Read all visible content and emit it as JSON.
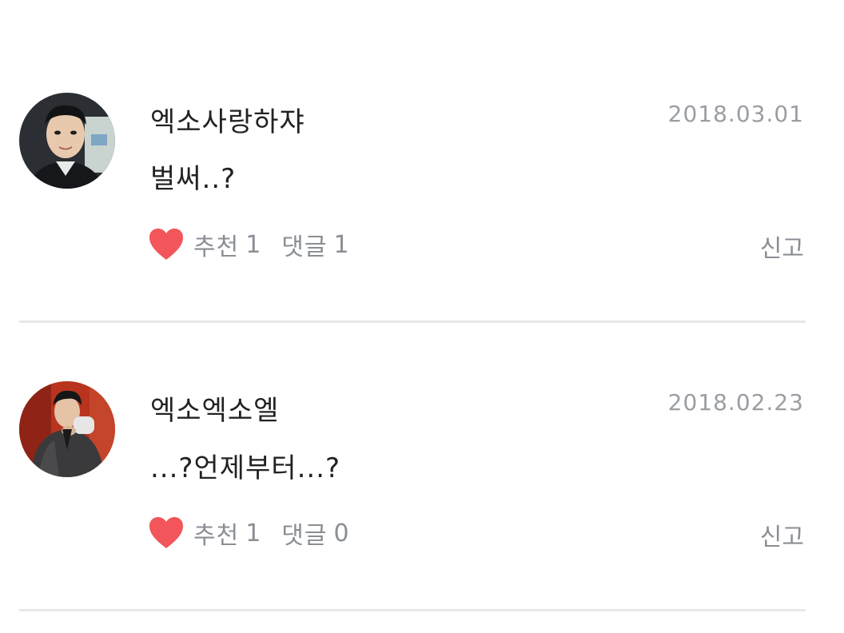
{
  "comments": [
    {
      "username": "엑소사랑하쟈",
      "date": "2018.03.01",
      "text": "벌써..?",
      "like_label": "추천",
      "like_count": "1",
      "reply_label": "댓글",
      "reply_count": "1",
      "report_label": "신고"
    },
    {
      "username": "엑소엑소엘",
      "date": "2018.02.23",
      "text": "...?언제부터...?",
      "like_label": "추천",
      "like_count": "1",
      "reply_label": "댓글",
      "reply_count": "0",
      "report_label": "신고"
    }
  ],
  "colors": {
    "heart": "#f2555a",
    "meta_text": "#8a8f95",
    "date_text": "#9a9ea3",
    "divider": "#e8e8ea"
  },
  "icons": {
    "like": "heart-icon"
  }
}
